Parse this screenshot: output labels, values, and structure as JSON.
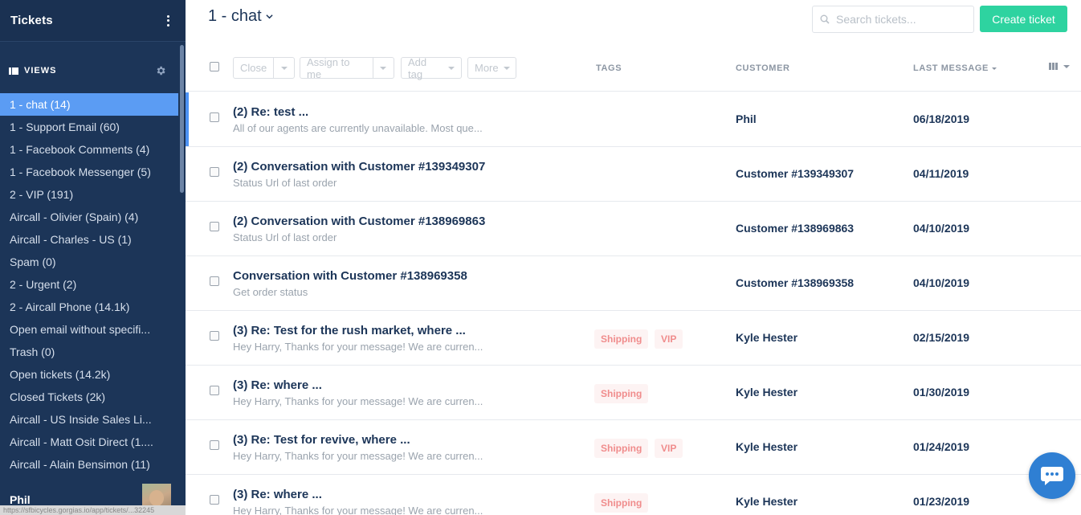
{
  "sidebar": {
    "title": "Tickets",
    "views_label": "VIEWS",
    "items": [
      {
        "label": "1 - chat (14)",
        "active": true
      },
      {
        "label": "1 - Support Email (60)"
      },
      {
        "label": "1 - Facebook Comments (4)"
      },
      {
        "label": "1 - Facebook Messenger (5)"
      },
      {
        "label": "2 - VIP (191)"
      },
      {
        "label": "Aircall - Olivier (Spain) (4)"
      },
      {
        "label": "Aircall - Charles - US (1)"
      },
      {
        "label": "Spam (0)"
      },
      {
        "label": "2 - Urgent (2)"
      },
      {
        "label": "2 - Aircall Phone (14.1k)"
      },
      {
        "label": "Open email without specifi..."
      },
      {
        "label": "Trash (0)"
      },
      {
        "label": "Open tickets (14.2k)"
      },
      {
        "label": "Closed Tickets (2k)"
      },
      {
        "label": "Aircall - US Inside Sales Li..."
      },
      {
        "label": "Aircall - Matt Osit Direct (1...."
      },
      {
        "label": "Aircall - Alain Bensimon (11)"
      }
    ],
    "user_name": "Phil",
    "status_url": "https://sfbicycles.gorgias.io/app/tickets/...32245"
  },
  "header": {
    "view_title": "1 - chat",
    "search_placeholder": "Search tickets...",
    "create_label": "Create ticket"
  },
  "toolbar": {
    "close_label": "Close",
    "assign_label": "Assign to me",
    "add_tag_label": "Add tag",
    "more_label": "More"
  },
  "columns": {
    "tags": "TAGS",
    "customer": "CUSTOMER",
    "last_message": "LAST MESSAGE"
  },
  "tickets": [
    {
      "subject": "(2) Re: test ...",
      "excerpt": "All of our agents are currently unavailable. Most que...",
      "tags": [],
      "customer": "Phil",
      "date": "06/18/2019",
      "active": true
    },
    {
      "subject": "(2) Conversation with Customer #139349307",
      "excerpt": "Status Url of last order",
      "tags": [],
      "customer": "Customer #139349307",
      "date": "04/11/2019"
    },
    {
      "subject": "(2) Conversation with Customer #138969863",
      "excerpt": "Status Url of last order",
      "tags": [],
      "customer": "Customer #138969863",
      "date": "04/10/2019"
    },
    {
      "subject": "Conversation with Customer #138969358",
      "excerpt": "Get order status",
      "tags": [],
      "customer": "Customer #138969358",
      "date": "04/10/2019"
    },
    {
      "subject": "(3) Re: Test for the rush market, where ...",
      "excerpt": "Hey Harry, Thanks for your message! We are curren...",
      "tags": [
        "Shipping",
        "VIP"
      ],
      "customer": "Kyle Hester",
      "date": "02/15/2019"
    },
    {
      "subject": "(3) Re: where ...",
      "excerpt": "Hey Harry, Thanks for your message! We are curren...",
      "tags": [
        "Shipping"
      ],
      "customer": "Kyle Hester",
      "date": "01/30/2019"
    },
    {
      "subject": "(3) Re: Test for revive, where ...",
      "excerpt": "Hey Harry, Thanks for your message! We are curren...",
      "tags": [
        "Shipping",
        "VIP"
      ],
      "customer": "Kyle Hester",
      "date": "01/24/2019"
    },
    {
      "subject": "(3) Re: where ...",
      "excerpt": "Hey Harry, Thanks for your message! We are curren...",
      "tags": [
        "Shipping"
      ],
      "customer": "Kyle Hester",
      "date": "01/23/2019"
    }
  ],
  "colors": {
    "sidebar_bg": "#1c3558",
    "active_view": "#5b9cf3",
    "primary_button": "#2ed3a0",
    "tag_text": "#f08c8c",
    "tag_bg": "#fdf3f3",
    "chat_widget": "#2f7fd3"
  },
  "icons": {
    "sidebar_menu": "kebab-icon",
    "views": "views-icon",
    "settings": "gear-icon",
    "search": "search-icon",
    "columns": "columns-icon",
    "chat": "chat-icon"
  }
}
